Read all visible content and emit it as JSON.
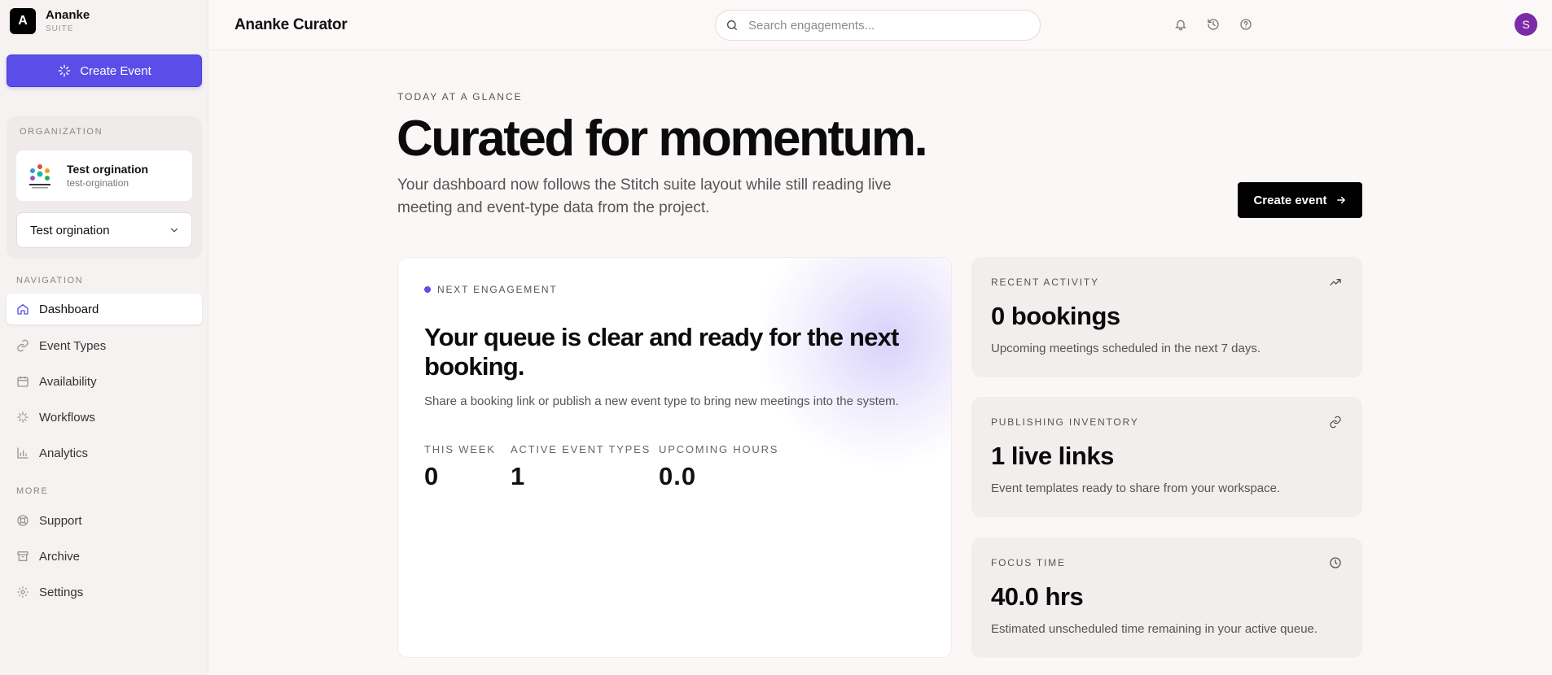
{
  "brand": {
    "logo_letter": "A",
    "name": "Ananke",
    "subtitle": "SUITE"
  },
  "sidebar": {
    "create_button": "Create Event",
    "organization": {
      "section_label": "ORGANIZATION",
      "name": "Test orgination",
      "slug": "test-orgination",
      "selected": "Test orgination"
    },
    "navigation_label": "NAVIGATION",
    "nav_items": [
      {
        "label": "Dashboard",
        "icon": "home-icon",
        "active": true
      },
      {
        "label": "Event Types",
        "icon": "link-icon"
      },
      {
        "label": "Availability",
        "icon": "calendar-icon"
      },
      {
        "label": "Workflows",
        "icon": "sparkle-icon"
      },
      {
        "label": "Analytics",
        "icon": "bar-chart-icon"
      }
    ],
    "more_label": "MORE",
    "more_items": [
      {
        "label": "Support",
        "icon": "lifebuoy-icon"
      },
      {
        "label": "Archive",
        "icon": "archive-icon"
      },
      {
        "label": "Settings",
        "icon": "gear-icon"
      }
    ]
  },
  "header": {
    "title": "Ananke Curator",
    "search_placeholder": "Search engagements...",
    "avatar_letter": "S"
  },
  "hero": {
    "eyebrow": "TODAY AT A GLANCE",
    "title": "Curated for momentum.",
    "description": "Your dashboard now follows the Stitch suite layout while still reading live meeting and event-type data from the project.",
    "button": "Create event"
  },
  "next_engagement": {
    "label": "NEXT ENGAGEMENT",
    "title": "Your queue is clear and ready for the next booking.",
    "description": "Share a booking link or publish a new event type to bring new meetings into the system.",
    "stats": [
      {
        "label": "THIS WEEK",
        "value": "0"
      },
      {
        "label": "ACTIVE EVENT TYPES",
        "value": "1"
      },
      {
        "label": "UPCOMING HOURS",
        "value": "0.0"
      }
    ]
  },
  "cards": [
    {
      "label": "RECENT ACTIVITY",
      "icon": "trending-up-icon",
      "value": "0 bookings",
      "description": "Upcoming meetings scheduled in the next 7 days."
    },
    {
      "label": "PUBLISHING INVENTORY",
      "icon": "link-icon",
      "value": "1 live links",
      "description": "Event templates ready to share from your workspace."
    },
    {
      "label": "FOCUS TIME",
      "icon": "clock-icon",
      "value": "40.0 hrs",
      "description": "Estimated unscheduled time remaining in your active queue."
    }
  ],
  "colors": {
    "accent": "#5a4de8",
    "avatar": "#7b2aa8",
    "background": "#faf7f6"
  }
}
